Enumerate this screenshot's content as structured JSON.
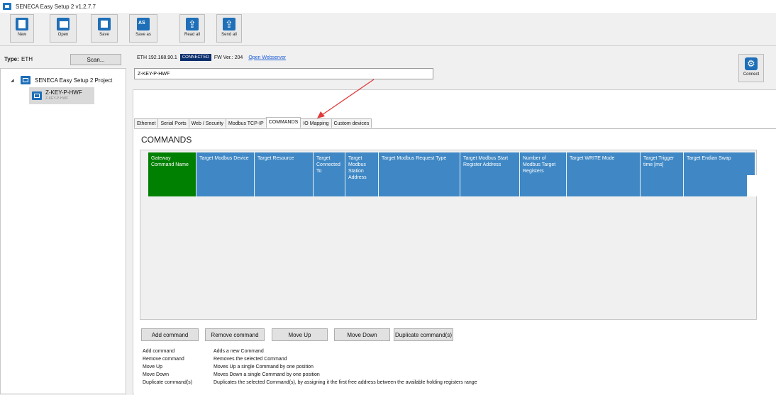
{
  "window": {
    "title": "SENECA Easy Setup 2 v1.2.7.7"
  },
  "toolbar": {
    "buttons": [
      {
        "label": "New",
        "icon": "new-document-icon"
      },
      {
        "label": "Open",
        "icon": "open-folder-icon"
      },
      {
        "label": "Save",
        "icon": "save-icon"
      },
      {
        "label": "Save as",
        "icon": "save-as-icon"
      },
      {
        "label": "Read all",
        "icon": "read-all-icon"
      },
      {
        "label": "Send all",
        "icon": "send-all-icon"
      }
    ]
  },
  "left": {
    "type_label": "Type:",
    "type_value": "ETH",
    "scan_label": "Scan...",
    "tree": {
      "root": "SENECA Easy Setup 2 Project",
      "child_title": "Z-KEY-P-HWF",
      "child_subtitle": "Z-KEY-P-HWF"
    }
  },
  "status": {
    "address": "ETH 192.168.90.1",
    "badge": "CONNECTED",
    "fw": "FW Ver.: 204",
    "webserver_link": "Open Webserver"
  },
  "device_name": "Z-KEY-P-HWF",
  "connect_label": "Connect",
  "tabs": [
    "Ethernet",
    "Serial Ports",
    "Web / Security",
    "Modbus TCP-IP",
    "COMMANDS",
    "IO Mapping",
    "Custom devices"
  ],
  "active_tab": "COMMANDS",
  "section_title": "COMMANDS",
  "grid": {
    "columns": [
      "Gateway Command Name",
      "Target Modbus Device",
      "Target Resource",
      "Target Connected To",
      "Target Modbus Station Address",
      "Target Modbus Request Type",
      "Target Modbus Start Register Address",
      "Number of Modbus Target Registers",
      "Target WRITE Mode",
      "Target Trigger time [ms]",
      "Target Endian Swap"
    ],
    "first_column_color": "#008000",
    "header_color": "#3f88c5"
  },
  "actions": {
    "add": "Add command",
    "remove": "Remove command",
    "move_up": "Move Up",
    "move_down": "Move Down",
    "duplicate": "Duplicate command(s)"
  },
  "legend": [
    {
      "name": "Add command",
      "desc": "Adds a new Command"
    },
    {
      "name": "Remove command",
      "desc": "Removes the selected Command"
    },
    {
      "name": "Move Up",
      "desc": "Moves Up a single Command by one position"
    },
    {
      "name": "Move Down",
      "desc": "Moves Down a single Command by one position"
    },
    {
      "name": "Duplicate command(s)",
      "desc": "Duplicates the selected Command(s), by assigning it the first free address between the available holding registers range"
    }
  ],
  "annotation_color": "#e03a3a"
}
